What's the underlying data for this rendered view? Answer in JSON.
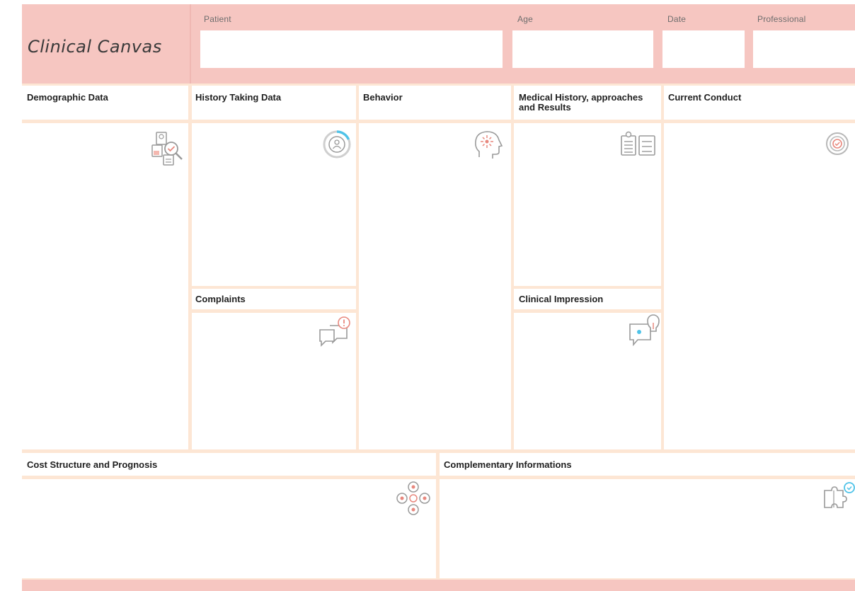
{
  "header": {
    "title": "Clinical Canvas",
    "fields": [
      {
        "label": "Patient",
        "value": ""
      },
      {
        "label": "Age",
        "value": ""
      },
      {
        "label": "Date",
        "value": ""
      },
      {
        "label": "Professional",
        "value": ""
      }
    ]
  },
  "sections": {
    "demographic": {
      "title": "Demographic Data",
      "icon": "demographic-search-icon"
    },
    "history_taking": {
      "title": "History Taking Data",
      "icon": "history-ring-icon"
    },
    "behavior": {
      "title": "Behavior",
      "icon": "head-brain-icon"
    },
    "medical_history": {
      "title": "Medical History, approaches and Results",
      "icon": "clipboard-list-icon"
    },
    "current_conduct": {
      "title": "Current Conduct",
      "icon": "target-check-icon"
    },
    "complaints": {
      "title": "Complaints",
      "icon": "speech-alert-icon"
    },
    "clinical_impression": {
      "title": "Clinical Impression",
      "icon": "idea-bubble-icon"
    },
    "cost_structure": {
      "title": "Cost Structure and Prognosis",
      "icon": "cost-nodes-icon"
    },
    "complementary": {
      "title": "Complementary Informations",
      "icon": "puzzle-icon"
    }
  },
  "colors": {
    "header_pink": "#f6c6c1",
    "grid_peach": "#fde6d4",
    "icon_gray": "#9a9a9a",
    "icon_accent": "#4fc3e8",
    "icon_red": "#e8887e"
  }
}
